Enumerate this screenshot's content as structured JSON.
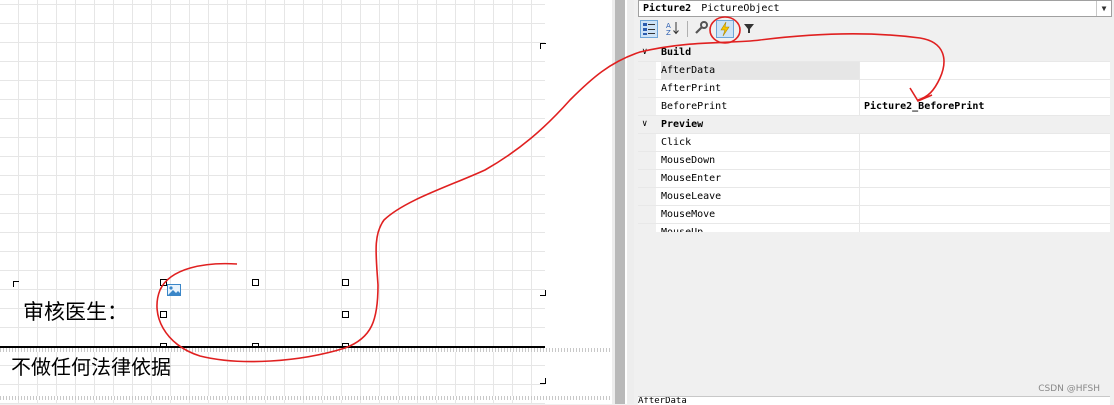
{
  "designer": {
    "label_reviewer": "审核医生：",
    "footer_text": "不做任何法律依据"
  },
  "properties": {
    "object_name": "Picture2",
    "object_type": "PictureObject",
    "categories": [
      {
        "name": "Build",
        "items": [
          {
            "name": "AfterData",
            "value": ""
          },
          {
            "name": "AfterPrint",
            "value": ""
          },
          {
            "name": "BeforePrint",
            "value": "Picture2_BeforePrint"
          }
        ]
      },
      {
        "name": "Preview",
        "items": [
          {
            "name": "Click",
            "value": ""
          },
          {
            "name": "MouseDown",
            "value": ""
          },
          {
            "name": "MouseEnter",
            "value": ""
          },
          {
            "name": "MouseLeave",
            "value": ""
          },
          {
            "name": "MouseMove",
            "value": ""
          },
          {
            "name": "MouseUp",
            "value": ""
          }
        ]
      }
    ],
    "description_partial": "AfterData"
  },
  "toolbar_icons": [
    "categorized-icon",
    "alphabetical-icon",
    "wrench-icon",
    "events-lightning-icon",
    "filter-icon"
  ],
  "watermark": "CSDN @HFSH",
  "colors": {
    "annotation": "#e02020",
    "events_active": "#cde3f7"
  }
}
